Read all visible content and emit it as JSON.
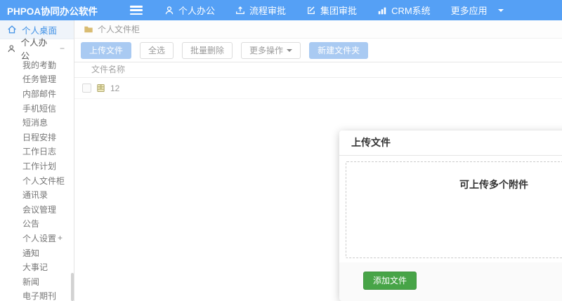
{
  "topbar": {
    "brand": "PHPOA协同办公软件",
    "nav": [
      {
        "label": "个人办公",
        "icon": "user-icon"
      },
      {
        "label": "流程审批",
        "icon": "process-approval-icon"
      },
      {
        "label": "集团审批",
        "icon": "edit-square-icon"
      },
      {
        "label": "CRM系统",
        "icon": "bar-chart-icon"
      },
      {
        "label": "更多应用",
        "icon": "caret-down-icon"
      }
    ]
  },
  "sidebar": {
    "desktop": {
      "label": "个人桌面",
      "icon": "home-icon"
    },
    "section": {
      "label": "个人办公",
      "icon": "user-icon",
      "collapse_glyph": "−"
    },
    "items": [
      {
        "label": "我的考勤"
      },
      {
        "label": "任务管理"
      },
      {
        "label": "内部邮件"
      },
      {
        "label": "手机短信"
      },
      {
        "label": "短消息"
      },
      {
        "label": "日程安排"
      },
      {
        "label": "工作日志"
      },
      {
        "label": "工作计划"
      },
      {
        "label": "个人文件柜"
      },
      {
        "label": "通讯录"
      },
      {
        "label": "会议管理"
      },
      {
        "label": "公告"
      },
      {
        "label": "个人设置",
        "suffix": "+"
      },
      {
        "label": "通知"
      },
      {
        "label": "大事记"
      },
      {
        "label": "新闻"
      },
      {
        "label": "电子期刊"
      }
    ]
  },
  "main": {
    "breadcrumb": {
      "label": "个人文件柜",
      "icon": "folder-icon"
    },
    "toolbar": {
      "upload": "上传文件",
      "select_all": "全选",
      "batch_delete": "批量删除",
      "more_ops": "更多操作",
      "new_folder": "新建文件夹"
    },
    "table": {
      "columns": [
        "文件名称"
      ],
      "rows": [
        {
          "name": "12",
          "checked": false,
          "icon": "file-cabinet-icon"
        }
      ]
    }
  },
  "modal": {
    "title": "上传文件",
    "dropzone_text": "可上传多个附件",
    "add_file_button": "添加文件"
  },
  "colors": {
    "topbar_blue": "#55a0f5",
    "sidebar_active_text": "#4292e6",
    "soft_button_blue": "#a9caf2",
    "green_button": "#47a447",
    "breadcrumb_folder": "#d9bc72",
    "row_folder_olive": "#b4ac62"
  }
}
